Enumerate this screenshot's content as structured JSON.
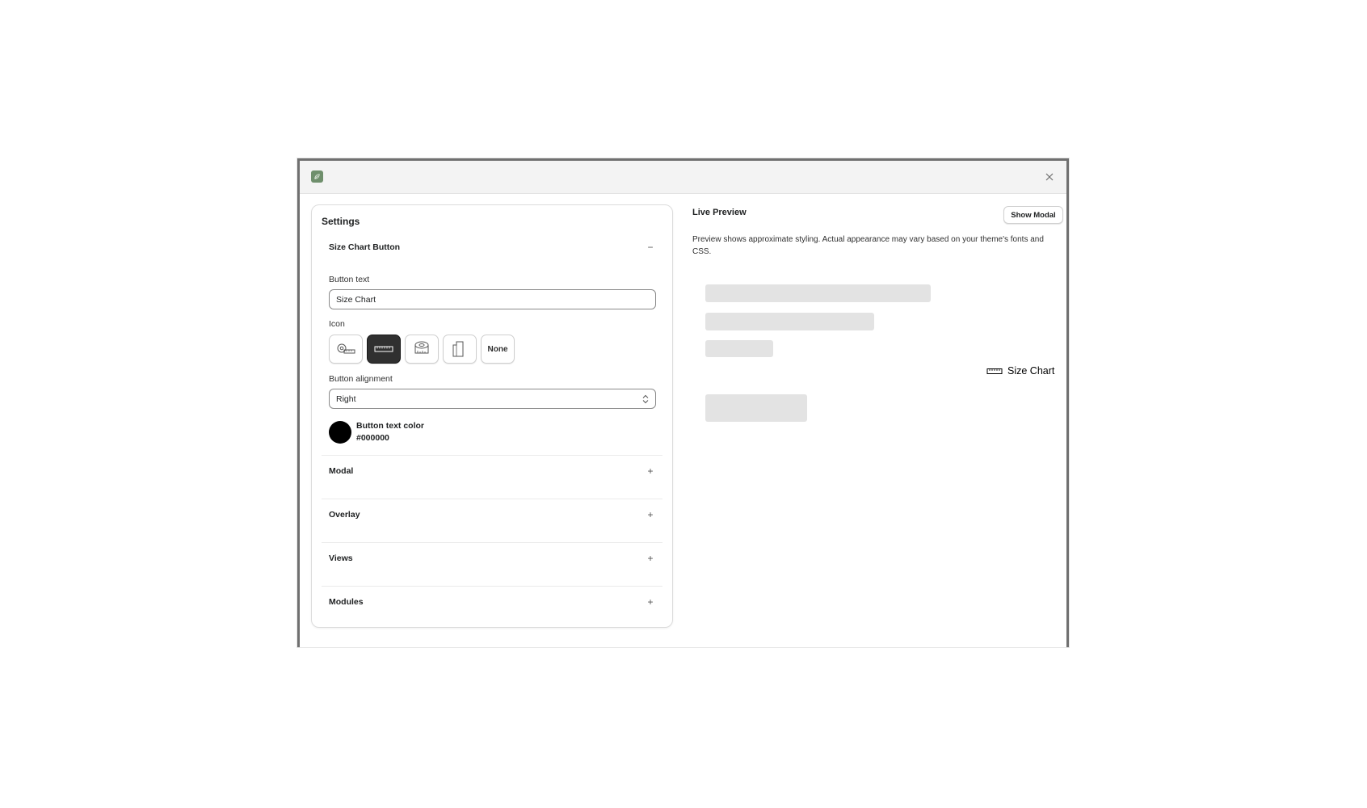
{
  "window": {
    "app_icon": "leaf-icon",
    "close_icon": "close-icon"
  },
  "settings": {
    "title": "Settings",
    "size_chart_button": {
      "header": "Size Chart Button",
      "toggle": "−",
      "button_text_label": "Button text",
      "button_text_value": "Size Chart",
      "icon_label": "Icon",
      "icons": [
        {
          "name": "tape-measure-icon",
          "selected": false
        },
        {
          "name": "ruler-icon",
          "selected": true
        },
        {
          "name": "tape-roll-icon",
          "selected": false
        },
        {
          "name": "garment-measure-icon",
          "selected": false
        },
        {
          "name": "none",
          "label": "None",
          "selected": false
        }
      ],
      "alignment_label": "Button alignment",
      "alignment_value": "Right",
      "text_color_label": "Button text color",
      "text_color_value": "#000000"
    },
    "sections": [
      {
        "label": "Modal",
        "toggle": "+"
      },
      {
        "label": "Overlay",
        "toggle": "+"
      },
      {
        "label": "Views",
        "toggle": "+"
      },
      {
        "label": "Modules",
        "toggle": "+"
      }
    ]
  },
  "preview": {
    "title": "Live Preview",
    "show_modal_label": "Show Modal",
    "note": "Preview shows approximate styling. Actual appearance may vary based on your theme's fonts and CSS.",
    "button_label": "Size Chart",
    "button_icon": "ruler-icon",
    "button_color": "#000000",
    "skeleton_color": "#e3e3e3"
  }
}
